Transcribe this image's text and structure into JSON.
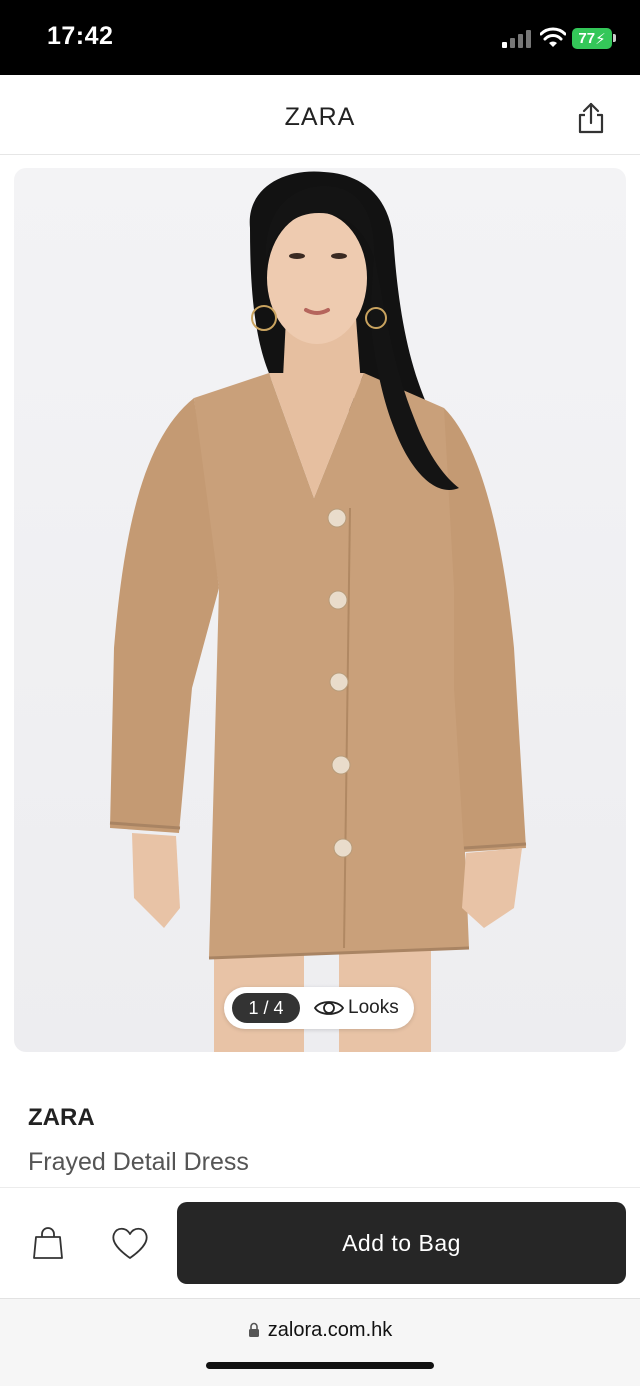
{
  "status_bar": {
    "time": "17:42",
    "battery": "77"
  },
  "header": {
    "title": "ZARA"
  },
  "gallery": {
    "counter": "1 / 4",
    "looks_label": "Looks"
  },
  "product": {
    "brand": "ZARA",
    "name": "Frayed Detail Dress"
  },
  "actions": {
    "add_to_bag_label": "Add to Bag"
  },
  "browser": {
    "url": "zalora.com.hk"
  },
  "colors": {
    "dress": "#c9a07a",
    "button_dark": "#262626",
    "battery_green": "#34c759"
  },
  "icons": [
    "signal-icon",
    "wifi-icon",
    "share-icon",
    "eye-icon",
    "bag-icon",
    "heart-icon",
    "lock-icon"
  ]
}
